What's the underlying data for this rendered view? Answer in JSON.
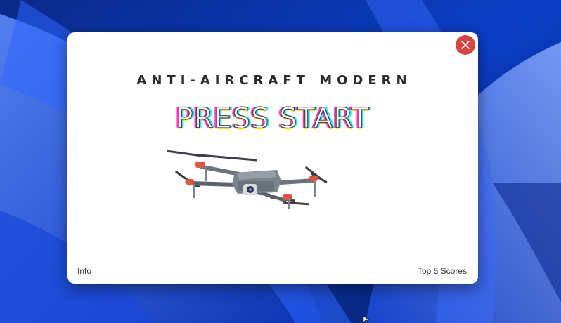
{
  "window": {
    "subtitle": "ANTI-AIRCRAFT MODERN",
    "start_label": "PRESS START",
    "close_color": "#d64541"
  },
  "footer": {
    "info_label": "Info",
    "scores_label": "Top 5 Scores"
  },
  "icons": {
    "close": "close-icon",
    "drone": "drone-illustration"
  },
  "colors": {
    "wallpaper": "#0b3ec7",
    "start_shadow_pink": "#ff3fb8",
    "start_shadow_cyan": "#2ee6ff",
    "start_shadow_yellow": "#f5e800"
  }
}
